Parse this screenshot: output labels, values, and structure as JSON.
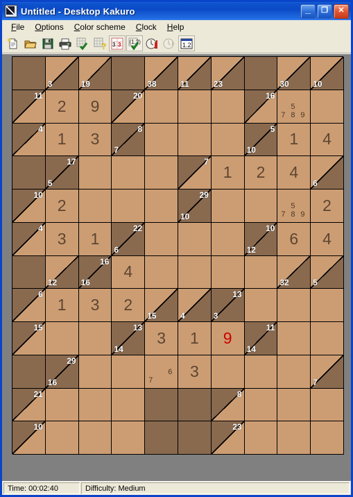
{
  "window": {
    "title": "Untitled - Desktop Kakuro",
    "icon": "kakuro-app-icon",
    "minimize_label": "_",
    "maximize_label": "❐",
    "close_label": "✕"
  },
  "menu": [
    {
      "label": "File",
      "mnemonic": "F"
    },
    {
      "label": "Options",
      "mnemonic": "O"
    },
    {
      "label": "Color scheme",
      "mnemonic": "C"
    },
    {
      "label": "Clock",
      "mnemonic": "C"
    },
    {
      "label": "Help",
      "mnemonic": "H"
    }
  ],
  "toolbar": [
    {
      "name": "new-puzzle-button",
      "icon": "new-document-icon",
      "enabled": true,
      "framed": false
    },
    {
      "name": "open-puzzle-button",
      "icon": "open-folder-icon",
      "enabled": true,
      "framed": false
    },
    {
      "name": "save-puzzle-button",
      "icon": "floppy-disk-icon",
      "enabled": true,
      "framed": false
    },
    {
      "name": "print-button",
      "icon": "printer-icon",
      "enabled": true,
      "framed": false
    },
    {
      "name": "check-solution-button",
      "icon": "grid-check-icon",
      "enabled": true,
      "framed": false
    },
    {
      "name": "hint-button",
      "icon": "grid-question-icon",
      "enabled": true,
      "framed": false
    },
    {
      "name": "show-errors-toggle",
      "icon": "red-digit-icon",
      "enabled": true,
      "framed": true,
      "label": "3"
    },
    {
      "name": "auto-pencil-toggle",
      "icon": "pencil-marks-check-icon",
      "enabled": true,
      "framed": true,
      "label": "(1,2)"
    },
    {
      "name": "timer-start-button",
      "icon": "clock-run-icon",
      "enabled": true,
      "framed": false
    },
    {
      "name": "timer-pause-button",
      "icon": "clock-pause-icon",
      "enabled": false,
      "framed": false
    },
    {
      "name": "candidates-toggle",
      "icon": "one-two-box-icon",
      "enabled": true,
      "framed": true,
      "label": "1.2"
    }
  ],
  "status": {
    "time_label": "Time: 00:02:40",
    "difficulty_label": "Difficulty: Medium"
  },
  "colors": {
    "open_cell": "#cc9d73",
    "block_cell": "#8a6a4f",
    "value_text": "#5d4531",
    "error_text": "#cc0000",
    "clue_text": "#ffffff",
    "title_bar": "#0b4ac6",
    "window_face": "#ece9d8",
    "board_background": "#808080"
  },
  "board": {
    "columns": 10,
    "rows": 12,
    "cells": [
      [
        {
          "t": "block"
        },
        {
          "t": "clue",
          "down": "3"
        },
        {
          "t": "clue",
          "down": "19"
        },
        {
          "t": "block"
        },
        {
          "t": "clue",
          "down": "38"
        },
        {
          "t": "clue",
          "down": "11"
        },
        {
          "t": "clue",
          "down": "23"
        },
        {
          "t": "block"
        },
        {
          "t": "clue",
          "down": "30"
        },
        {
          "t": "clue",
          "down": "10"
        }
      ],
      [
        {
          "t": "clue",
          "across": "11"
        },
        {
          "t": "open",
          "v": "2"
        },
        {
          "t": "open",
          "v": "9"
        },
        {
          "t": "clue",
          "across": "20"
        },
        {
          "t": "open"
        },
        {
          "t": "open"
        },
        {
          "t": "open"
        },
        {
          "t": "clue",
          "across": "16"
        },
        {
          "t": "open",
          "pencil": [
            5,
            7,
            8,
            9
          ]
        },
        {
          "t": "open"
        }
      ],
      [
        {
          "t": "clue",
          "across": "4"
        },
        {
          "t": "open",
          "v": "1"
        },
        {
          "t": "open",
          "v": "3"
        },
        {
          "t": "clue",
          "across": "8",
          "down": "7"
        },
        {
          "t": "open"
        },
        {
          "t": "open"
        },
        {
          "t": "open"
        },
        {
          "t": "clue",
          "across": "5",
          "down": "10"
        },
        {
          "t": "open",
          "v": "1"
        },
        {
          "t": "open",
          "v": "4"
        }
      ],
      [
        {
          "t": "block"
        },
        {
          "t": "clue",
          "across": "17",
          "down": "5"
        },
        {
          "t": "open"
        },
        {
          "t": "open"
        },
        {
          "t": "open"
        },
        {
          "t": "clue",
          "across": "7"
        },
        {
          "t": "open",
          "v": "1"
        },
        {
          "t": "open",
          "v": "2"
        },
        {
          "t": "open",
          "v": "4"
        },
        {
          "t": "clue",
          "down": "6"
        }
      ],
      [
        {
          "t": "clue",
          "across": "10"
        },
        {
          "t": "open",
          "v": "2"
        },
        {
          "t": "open"
        },
        {
          "t": "open"
        },
        {
          "t": "open"
        },
        {
          "t": "clue",
          "across": "29",
          "down": "10"
        },
        {
          "t": "open"
        },
        {
          "t": "open"
        },
        {
          "t": "open",
          "pencil": [
            5,
            7,
            8,
            9
          ]
        },
        {
          "t": "open",
          "v": "2"
        }
      ],
      [
        {
          "t": "clue",
          "across": "4"
        },
        {
          "t": "open",
          "v": "3"
        },
        {
          "t": "open",
          "v": "1"
        },
        {
          "t": "clue",
          "across": "22",
          "down": "6"
        },
        {
          "t": "open"
        },
        {
          "t": "open"
        },
        {
          "t": "open"
        },
        {
          "t": "clue",
          "across": "10",
          "down": "12"
        },
        {
          "t": "open",
          "v": "6"
        },
        {
          "t": "open",
          "v": "4"
        }
      ],
      [
        {
          "t": "block"
        },
        {
          "t": "clue",
          "down": "12"
        },
        {
          "t": "clue",
          "across": "16",
          "down": "16"
        },
        {
          "t": "open",
          "v": "4"
        },
        {
          "t": "open"
        },
        {
          "t": "open"
        },
        {
          "t": "open"
        },
        {
          "t": "open"
        },
        {
          "t": "clue",
          "down": "32"
        },
        {
          "t": "clue",
          "down": "5"
        }
      ],
      [
        {
          "t": "clue",
          "across": "6"
        },
        {
          "t": "open",
          "v": "1"
        },
        {
          "t": "open",
          "v": "3"
        },
        {
          "t": "open",
          "v": "2"
        },
        {
          "t": "clue",
          "down": "15"
        },
        {
          "t": "clue",
          "down": "4"
        },
        {
          "t": "clue",
          "across": "13",
          "down": "3"
        },
        {
          "t": "open"
        },
        {
          "t": "open"
        },
        {
          "t": "open"
        }
      ],
      [
        {
          "t": "clue",
          "across": "15"
        },
        {
          "t": "open"
        },
        {
          "t": "open"
        },
        {
          "t": "clue",
          "across": "13",
          "down": "14"
        },
        {
          "t": "open",
          "v": "3"
        },
        {
          "t": "open",
          "v": "1"
        },
        {
          "t": "open",
          "v": "9",
          "err": true
        },
        {
          "t": "clue",
          "across": "11",
          "down": "14"
        },
        {
          "t": "open"
        },
        {
          "t": "open"
        }
      ],
      [
        {
          "t": "block"
        },
        {
          "t": "clue",
          "across": "29",
          "down": "16"
        },
        {
          "t": "open"
        },
        {
          "t": "open"
        },
        {
          "t": "open",
          "pencil": [
            6,
            7
          ]
        },
        {
          "t": "open",
          "v": "3"
        },
        {
          "t": "open"
        },
        {
          "t": "open"
        },
        {
          "t": "open"
        },
        {
          "t": "clue",
          "down": "7"
        }
      ],
      [
        {
          "t": "clue",
          "across": "21"
        },
        {
          "t": "open"
        },
        {
          "t": "open"
        },
        {
          "t": "open"
        },
        {
          "t": "block"
        },
        {
          "t": "block"
        },
        {
          "t": "clue",
          "across": "8"
        },
        {
          "t": "open"
        },
        {
          "t": "open"
        },
        {
          "t": "open"
        }
      ],
      [
        {
          "t": "clue",
          "across": "10"
        },
        {
          "t": "open"
        },
        {
          "t": "open"
        },
        {
          "t": "open"
        },
        {
          "t": "block"
        },
        {
          "t": "block"
        },
        {
          "t": "clue",
          "across": "23"
        },
        {
          "t": "open"
        },
        {
          "t": "open"
        },
        {
          "t": "open"
        }
      ]
    ]
  }
}
